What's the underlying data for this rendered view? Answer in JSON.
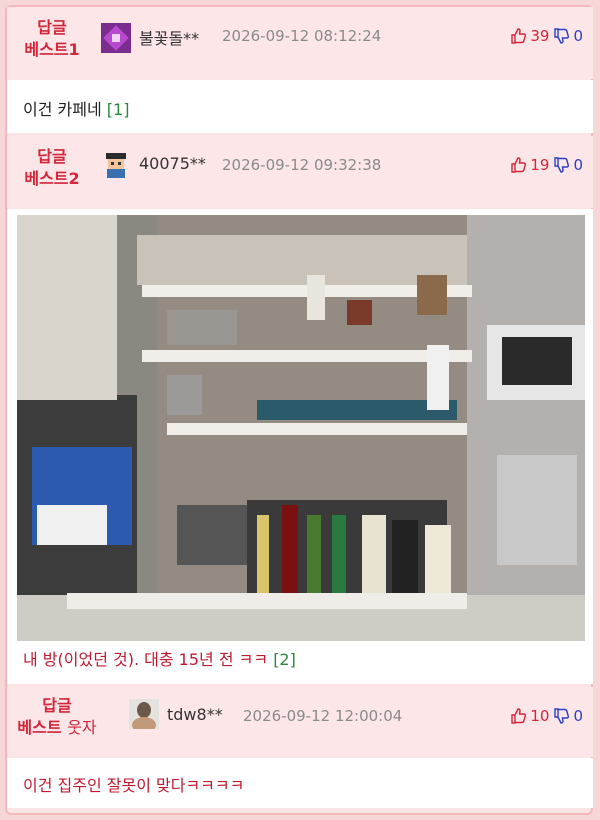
{
  "comments": [
    {
      "badge_line1": "답글",
      "badge_line2": "베스트1",
      "nickname": "불꽃돌**",
      "date": "2026-09-12 08:12:24",
      "upvotes": "39",
      "downvotes": "0",
      "text": "이건 카페네",
      "reply_ref": "[1]"
    },
    {
      "badge_line1": "답글",
      "badge_line2": "베스트2",
      "nickname": "40075**",
      "date": "2026-09-12 09:32:38",
      "upvotes": "19",
      "downvotes": "0",
      "text": "내 방(이었던 것). 대충 15년 전 ㅋㅋ",
      "reply_ref": "[2]"
    },
    {
      "badge_line1": "답글",
      "badge_line2": "베스트",
      "badge_suffix": "웃자",
      "nickname": "tdw8**",
      "date": "2026-09-12 12:00:04",
      "upvotes": "10",
      "downvotes": "0",
      "text": "이건 집주인 잘못이 맞다ㅋㅋㅋㅋ"
    }
  ],
  "icons": {
    "up": "thumbs-up-icon",
    "down": "thumbs-down-icon"
  },
  "colors": {
    "best_red": "#d3263b",
    "down_blue": "#2a3fc4",
    "ref_green": "#2b8a3e"
  }
}
